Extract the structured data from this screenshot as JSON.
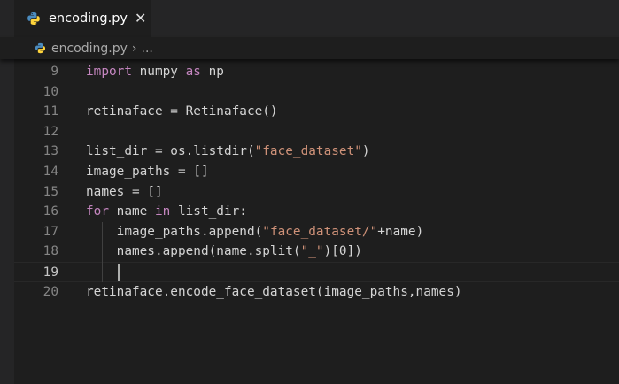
{
  "tab": {
    "filename": "encoding.py",
    "icon": "python-file-icon",
    "close_glyph": "✕"
  },
  "breadcrumb": {
    "file": "encoding.py",
    "separator": "›",
    "more": "..."
  },
  "colors": {
    "python_blue": "#4b8bbe",
    "python_yellow": "#ffd43b",
    "keyword": "#c586c0",
    "string": "#ce9178",
    "text": "#d4d4d4",
    "line_number": "#858585"
  },
  "editor": {
    "current_line": 19,
    "lines": [
      {
        "number": "9",
        "tokens": [
          [
            "kw",
            "import"
          ],
          [
            "p",
            " numpy "
          ],
          [
            "kw",
            "as"
          ],
          [
            "p",
            " np"
          ]
        ]
      },
      {
        "number": "10",
        "tokens": []
      },
      {
        "number": "11",
        "tokens": [
          [
            "p",
            "retinaface = Retinaface()"
          ]
        ]
      },
      {
        "number": "12",
        "tokens": []
      },
      {
        "number": "13",
        "tokens": [
          [
            "p",
            "list_dir = os.listdir("
          ],
          [
            "str",
            "\"face_dataset\""
          ],
          [
            "p",
            ")"
          ]
        ]
      },
      {
        "number": "14",
        "tokens": [
          [
            "p",
            "image_paths = []"
          ]
        ]
      },
      {
        "number": "15",
        "tokens": [
          [
            "p",
            "names = []"
          ]
        ]
      },
      {
        "number": "16",
        "tokens": [
          [
            "kw",
            "for"
          ],
          [
            "p",
            " name "
          ],
          [
            "kw",
            "in"
          ],
          [
            "p",
            " list_dir:"
          ]
        ]
      },
      {
        "number": "17",
        "tokens": [
          [
            "p",
            "    image_paths.append("
          ],
          [
            "str",
            "\"face_dataset/\""
          ],
          [
            "p",
            "+name)"
          ]
        ]
      },
      {
        "number": "18",
        "tokens": [
          [
            "p",
            "    names.append(name.split("
          ],
          [
            "str",
            "\"_\""
          ],
          [
            "p",
            ")[0])"
          ]
        ]
      },
      {
        "number": "19",
        "tokens": [
          [
            "p",
            "    "
          ]
        ]
      },
      {
        "number": "20",
        "tokens": [
          [
            "p",
            "retinaface.encode_face_dataset(image_paths,names)"
          ]
        ]
      }
    ]
  }
}
